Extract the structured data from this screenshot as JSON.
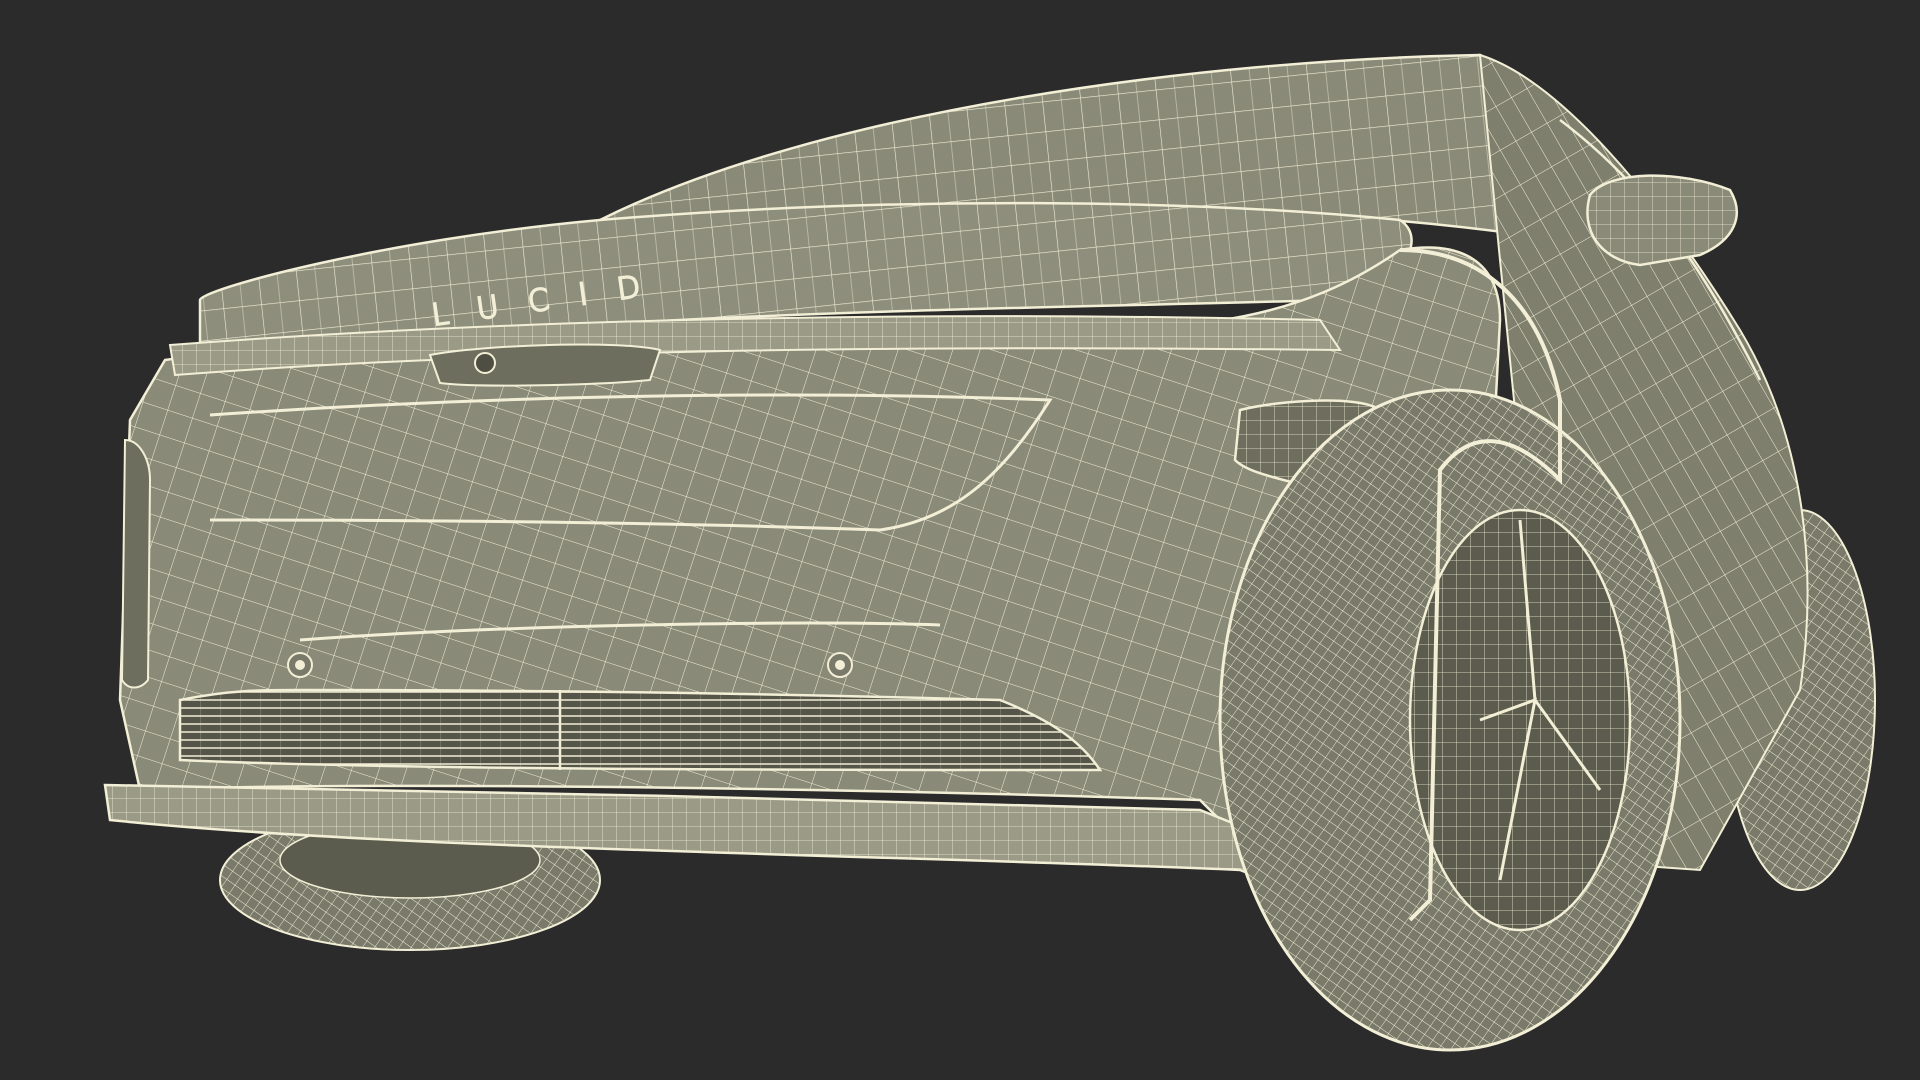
{
  "scene": {
    "background_color": "#2b2b2b",
    "body_fill": "#8a8a78",
    "body_shade": "#6e6e5e",
    "wire_color": "#f2efd6",
    "dark_cavity": "#4e4e42"
  },
  "badge": {
    "text": "LUCID"
  }
}
